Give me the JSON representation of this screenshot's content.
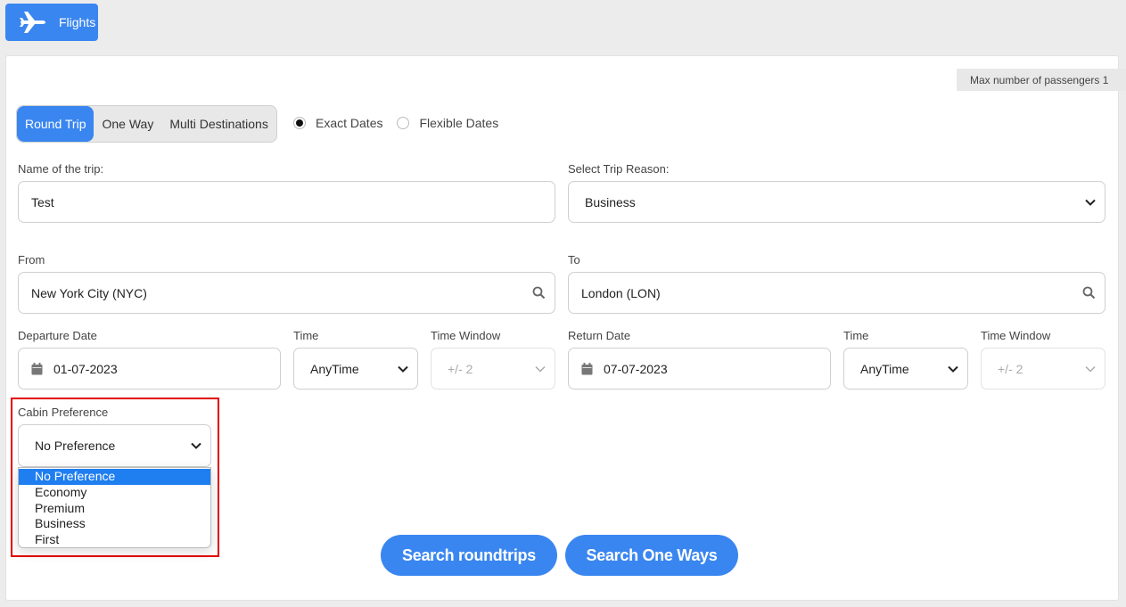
{
  "tab": {
    "label": "Flights"
  },
  "max_passengers": "Max number of passengers 1",
  "trip_types": [
    {
      "label": "Round Trip",
      "active": true
    },
    {
      "label": "One Way",
      "active": false
    },
    {
      "label": "Multi Destinations",
      "active": false
    }
  ],
  "date_modes": [
    {
      "label": "Exact Dates",
      "checked": true
    },
    {
      "label": "Flexible Dates",
      "checked": false
    }
  ],
  "form": {
    "trip_name_label": "Name of the trip:",
    "trip_name_value": "Test",
    "trip_reason_label": "Select Trip Reason:",
    "trip_reason_value": "Business",
    "from_label": "From",
    "from_value": "New York City (NYC)",
    "to_label": "To",
    "to_value": "London (LON)",
    "departure_date_label": "Departure Date",
    "departure_date_value": "01-07-2023",
    "departure_time_label": "Time",
    "departure_time_value": "AnyTime",
    "departure_window_label": "Time Window",
    "departure_window_value": "+/- 2",
    "return_date_label": "Return Date",
    "return_date_value": "07-07-2023",
    "return_time_label": "Time",
    "return_time_value": "AnyTime",
    "return_window_label": "Time Window",
    "return_window_value": "+/- 2",
    "cabin_label": "Cabin Preference",
    "cabin_value": "No Preference",
    "cabin_options": [
      "No Preference",
      "Economy",
      "Premium",
      "Business",
      "First"
    ]
  },
  "buttons": {
    "search_roundtrips": "Search roundtrips",
    "search_one_ways": "Search One Ways"
  },
  "colors": {
    "accent": "#3a86f0",
    "highlight": "#e30000",
    "option_selected": "#1f7ef0"
  }
}
